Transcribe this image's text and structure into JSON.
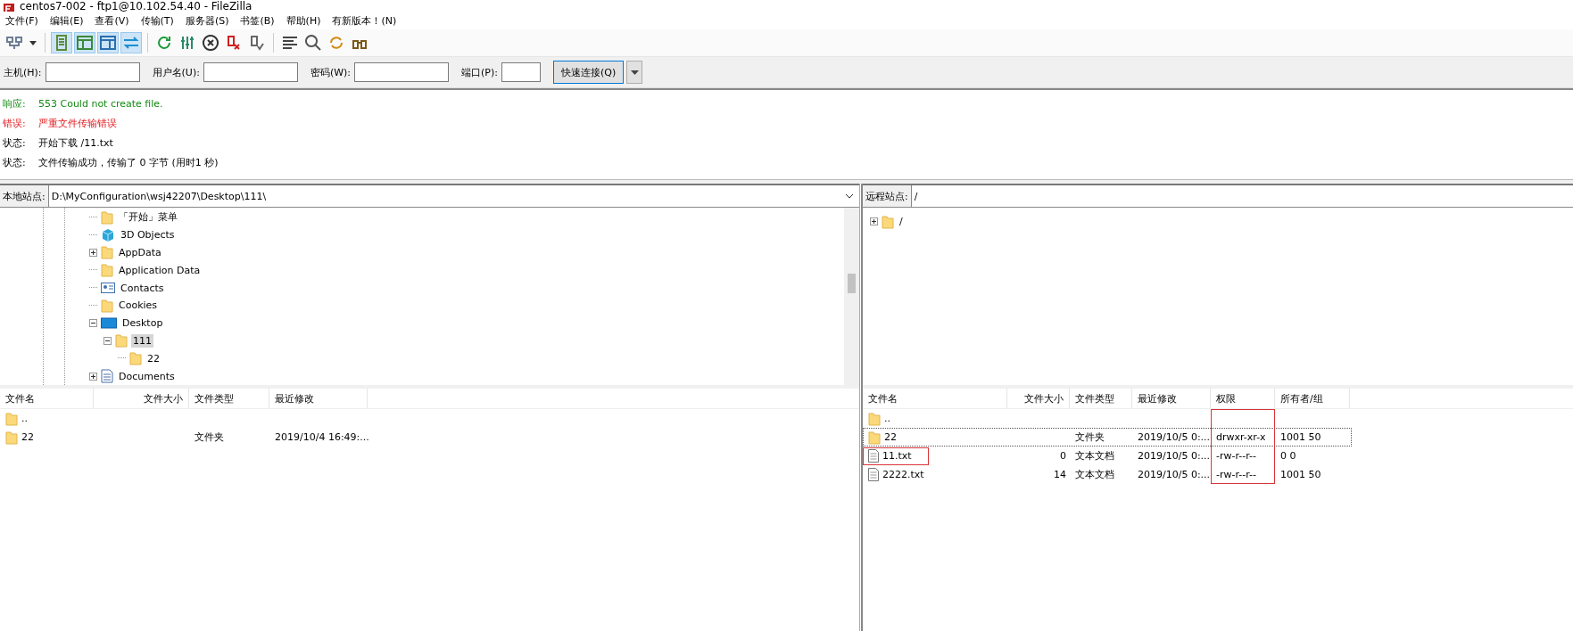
{
  "window": {
    "title": "centos7-002 - ftp1@10.102.54.40 - FileZilla"
  },
  "menu": [
    "文件(F)",
    "编辑(E)",
    "查看(V)",
    "传输(T)",
    "服务器(S)",
    "书签(B)",
    "帮助(H)",
    "有新版本！(N)"
  ],
  "toolbar": [
    {
      "kind": "sitemanager",
      "selected": false
    },
    {
      "kind": "log",
      "selected": true
    },
    {
      "kind": "localtree",
      "selected": true
    },
    {
      "kind": "remotetree",
      "selected": true
    },
    {
      "kind": "queue",
      "selected": true
    },
    {
      "kind": "refresh",
      "selected": false
    },
    {
      "kind": "process",
      "selected": false
    },
    {
      "kind": "cancel",
      "selected": false
    },
    {
      "kind": "disconnect",
      "selected": false
    },
    {
      "kind": "reconnect",
      "selected": false
    },
    {
      "kind": "filter",
      "selected": false
    },
    {
      "kind": "compare",
      "selected": false
    },
    {
      "kind": "sync",
      "selected": false
    },
    {
      "kind": "find",
      "selected": false
    }
  ],
  "quickconnect": {
    "fields": [
      {
        "label": "主机(H):",
        "kind": "wide"
      },
      {
        "label": "用户名(U):",
        "kind": "wide"
      },
      {
        "label": "密码(W):",
        "kind": "wide"
      },
      {
        "label": "端口(P):",
        "kind": "narrow"
      }
    ],
    "button": "快速连接(Q)"
  },
  "log": [
    {
      "prefix": "响应:",
      "text": "553 Could not create file.",
      "kind": "response"
    },
    {
      "prefix": "错误:",
      "text": "严重文件传输错误",
      "kind": "error"
    },
    {
      "prefix": "状态:",
      "text": "开始下载 /11.txt",
      "kind": "status"
    },
    {
      "prefix": "状态:",
      "text": "文件传输成功，传输了 0 字节 (用时1 秒)",
      "kind": "status"
    }
  ],
  "local": {
    "site_label": "本地站点:",
    "path": "D:\\MyConfiguration\\wsj42207\\Desktop\\111\\",
    "tree": [
      {
        "name": "「开始」菜单",
        "kind": "folder",
        "expandable": false,
        "selected": false
      },
      {
        "name": "3D Objects",
        "kind": "cube",
        "expandable": false,
        "selected": false
      },
      {
        "name": "AppData",
        "kind": "folder",
        "expandable": true,
        "expanded": false,
        "selected": false
      },
      {
        "name": "Application Data",
        "kind": "folder",
        "expandable": false,
        "selected": false
      },
      {
        "name": "Contacts",
        "kind": "contact",
        "expandable": false,
        "selected": false
      },
      {
        "name": "Cookies",
        "kind": "folder",
        "expandable": false,
        "selected": false
      },
      {
        "name": "Desktop",
        "kind": "desktop",
        "expandable": true,
        "expanded": true,
        "selected": false,
        "children": [
          {
            "name": "111",
            "kind": "folder",
            "expandable": true,
            "expanded": true,
            "selected": true,
            "children": [
              {
                "name": "22",
                "kind": "folder",
                "expandable": false,
                "selected": false
              }
            ]
          }
        ]
      },
      {
        "name": "Documents",
        "kind": "document",
        "expandable": true,
        "expanded": false,
        "selected": false
      }
    ],
    "columns": [
      "文件名",
      "文件大小",
      "文件类型",
      "最近修改"
    ],
    "files": [
      {
        "kind": "folder",
        "cells": [
          "..",
          "",
          "",
          ""
        ]
      },
      {
        "kind": "folder",
        "cells": [
          "22",
          "",
          "文件夹",
          "2019/10/4 16:49:..."
        ]
      }
    ]
  },
  "remote": {
    "site_label": "远程站点:",
    "path": "/",
    "tree": [
      {
        "name": "/",
        "kind": "folder",
        "expandable": true,
        "expanded": false,
        "selected": false
      }
    ],
    "columns": [
      {
        "label": "文件名",
        "marked": false
      },
      {
        "label": "文件大小",
        "marked": false
      },
      {
        "label": "文件类型",
        "marked": false
      },
      {
        "label": "最近修改",
        "marked": false
      },
      {
        "label": "权限",
        "marked": true
      },
      {
        "label": "所有者/组",
        "marked": false
      }
    ],
    "files": [
      {
        "kind": "folder",
        "focused": false,
        "name_marked": false,
        "cells": [
          "..",
          "",
          "",
          "",
          "",
          ""
        ]
      },
      {
        "kind": "folder",
        "focused": true,
        "name_marked": false,
        "cells": [
          "22",
          "",
          "文件夹",
          "2019/10/5 0:...",
          "drwxr-xr-x",
          "1001 50"
        ]
      },
      {
        "kind": "file",
        "focused": false,
        "name_marked": true,
        "cells": [
          "11.txt",
          "0",
          "文本文档",
          "2019/10/5 0:...",
          "-rw-r--r--",
          "0 0"
        ]
      },
      {
        "kind": "file",
        "focused": false,
        "name_marked": false,
        "cells": [
          "2222.txt",
          "14",
          "文本文档",
          "2019/10/5 0:...",
          "-rw-r--r--",
          "1001 50"
        ]
      }
    ]
  }
}
